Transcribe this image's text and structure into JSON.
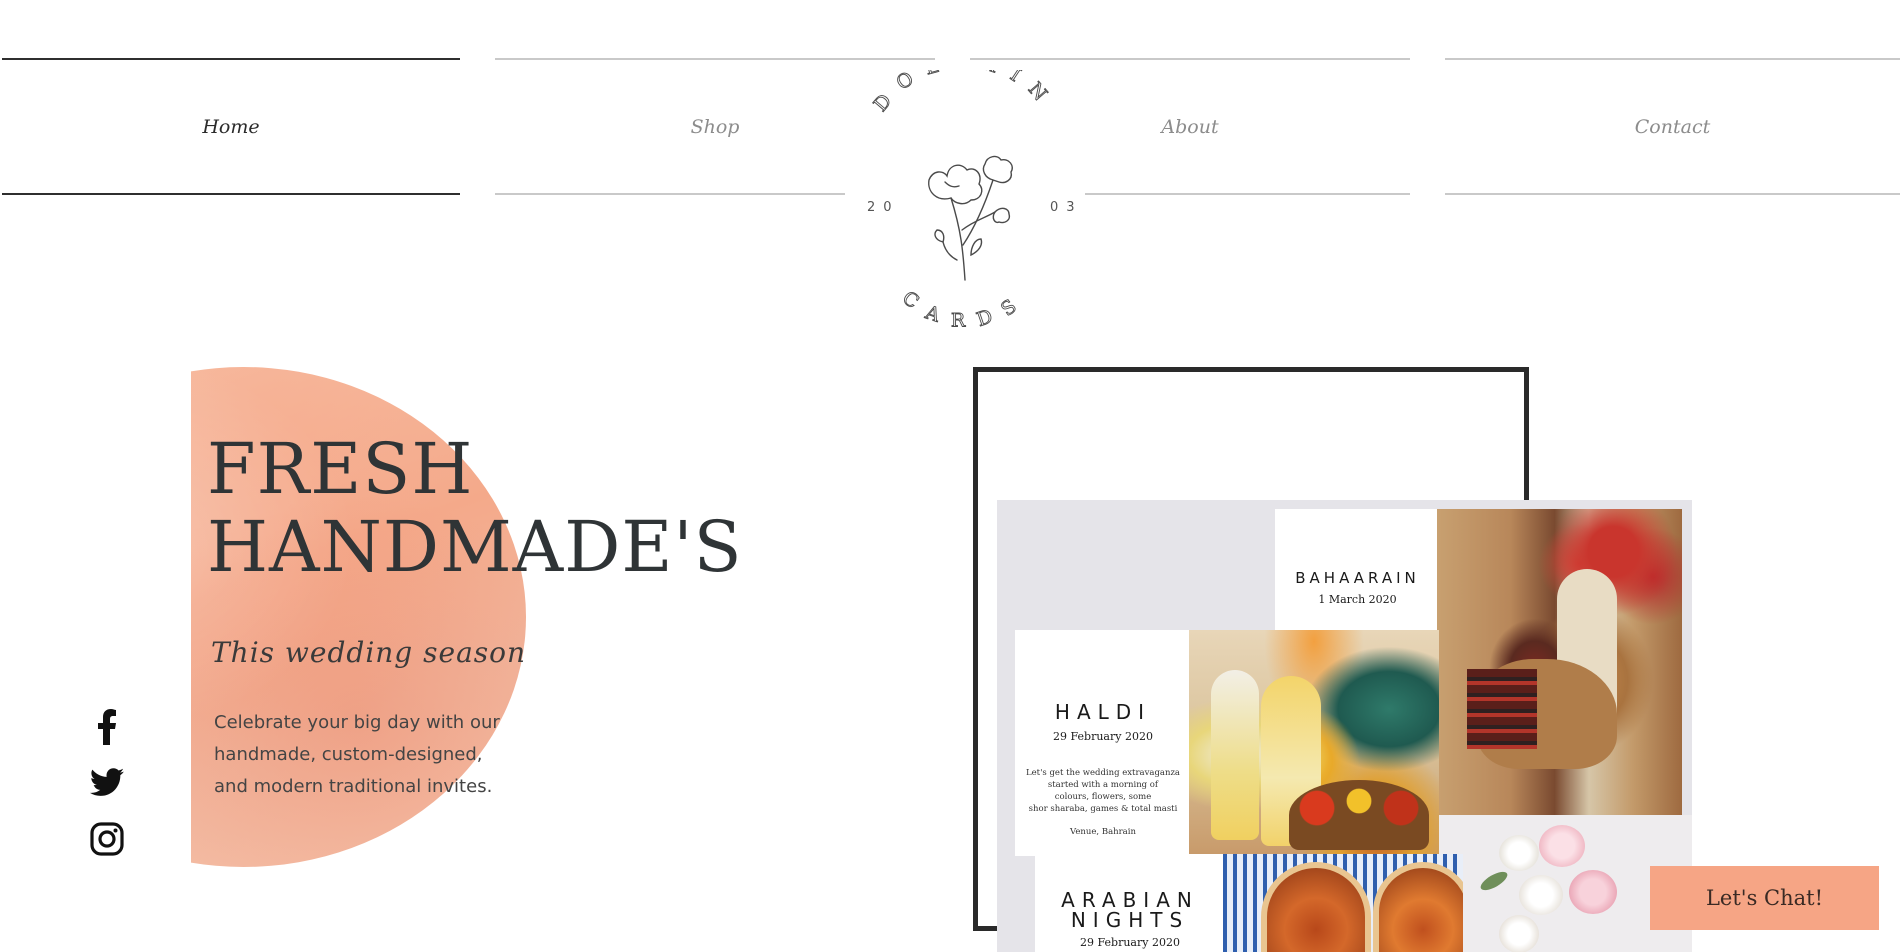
{
  "nav": {
    "items": [
      {
        "label": "Home",
        "active": true
      },
      {
        "label": "Shop",
        "active": false
      },
      {
        "label": "About",
        "active": false
      },
      {
        "label": "Contact",
        "active": false
      }
    ]
  },
  "logo": {
    "top_text": "DOLPHIN",
    "bottom_text": "CARDS",
    "year_left": "20",
    "year_right": "03",
    "icon": "flower-icon"
  },
  "hero": {
    "title_line1": "FRESH",
    "title_line2": "HANDMADE'S",
    "subtitle": "This wedding season",
    "body_line1": "Celebrate your big day with our",
    "body_line2": "handmade, custom-designed,",
    "body_line3": "and modern traditional invites."
  },
  "social": {
    "icons": [
      "facebook-icon",
      "twitter-icon",
      "instagram-icon"
    ]
  },
  "collage": {
    "bahaarain": {
      "title": "BAHAARAIN",
      "date": "1 March 2020"
    },
    "haldi": {
      "title": "HALDI",
      "date": "29 February 2020",
      "blurb_line1": "Let's get the wedding extravaganza",
      "blurb_line2": "started with a morning of",
      "blurb_line3": "colours, flowers, some",
      "blurb_line4": "shor sharaba, games & total masti",
      "venue": "Venue, Bahrain"
    },
    "arabian": {
      "title_line1": "ARABIAN",
      "title_line2": "NIGHTS",
      "date": "29 February 2020"
    }
  },
  "chat": {
    "label": "Let's Chat!"
  },
  "colors": {
    "accent": "#f6a585",
    "blob": "#f4a98a",
    "frame": "#2a2a2a",
    "nav_active_line": "#2f2f2f",
    "nav_line": "#c9c9c9"
  }
}
